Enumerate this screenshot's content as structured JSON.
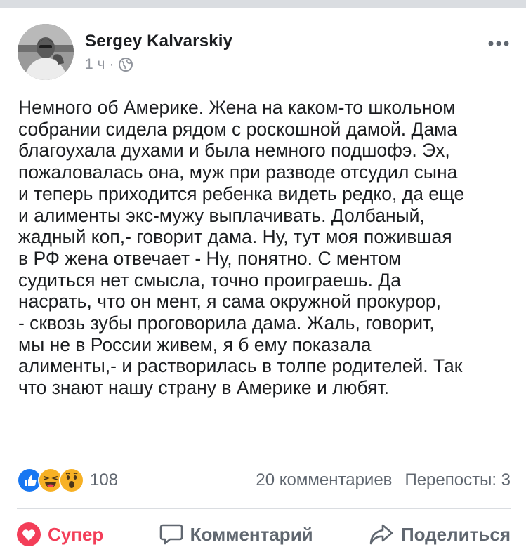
{
  "post": {
    "author": "Sergey Kalvarskiy",
    "time": "1 ч",
    "separator": "·",
    "privacy_icon": "globe-icon",
    "more_icon": "more-horizontal-icon",
    "text_lines": [
      "Немного об Америке. Жена на каком-то школьном",
      "собрании сидела рядом с роскошной дамой. Дама",
      "благоухала духами и была немного подшофэ. Эх,",
      "пожаловалась она, муж при разводе отсудил сына",
      "и теперь приходится ребенка видеть редко, да еще",
      "и алименты экс-мужу выплачивать. Долбаный,",
      "жадный коп,- говорит дама. Ну, тут моя пожившая",
      "в РФ жена отвечает - Ну, понятно. С  ментом",
      "судиться нет смысла, точно проиграешь. Да",
      "насрать, что он мент, я сама  окружной прокурор,",
      "- сквозь зубы проговорила дама. Жаль, говорит,",
      "мы не в России живем, я б ему показала",
      "алименты,- и растворилась в толпе родителей. Так",
      "что знают нашу страну в Америке и любят."
    ]
  },
  "stats": {
    "reactions": [
      "like",
      "haha",
      "wow"
    ],
    "reaction_count": "108",
    "comments": "20 комментариев",
    "shares": "Перепосты: 3"
  },
  "actions": {
    "love": "Супер",
    "comment": "Комментарий",
    "share": "Поделиться"
  },
  "colors": {
    "like_blue": "#1877f2",
    "love_red": "#f33e58",
    "emoji_yellow": "#f7b125",
    "muted_text": "#606770"
  }
}
